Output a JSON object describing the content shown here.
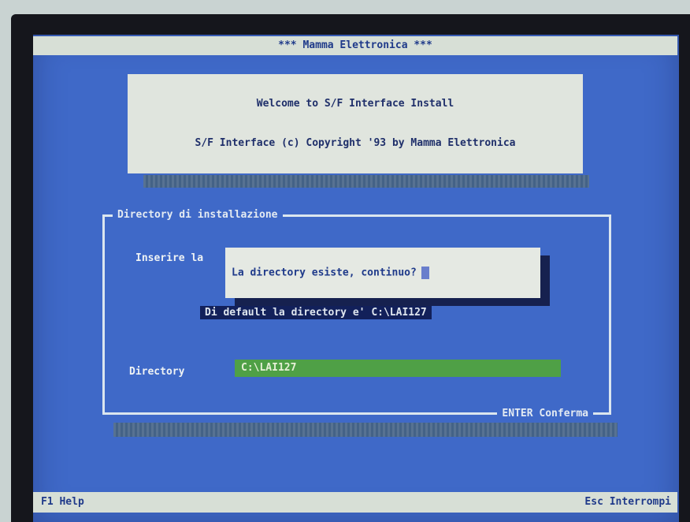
{
  "window": {
    "title": "*** Mamma Elettronica ***"
  },
  "welcome": {
    "line1": "Welcome to S/F Interface Install",
    "line2": "S/F Interface (c) Copyright '93 by Mamma Elettronica"
  },
  "install_panel": {
    "title": "Directory di installazione",
    "insert_label": "Inserire la",
    "footer": "ENTER Conferma"
  },
  "dialog": {
    "message": "La directory esiste, continuo?"
  },
  "hint": {
    "text": "Di default la directory e' C:\\LAI127"
  },
  "directory": {
    "label": "Directory",
    "value": "C:\\LAI127"
  },
  "statusbar": {
    "left": "F1 Help",
    "right": "Esc Interrompi"
  },
  "colors": {
    "screen_bg": "#3f69c8",
    "bar_bg": "#d7dfd6",
    "field_bg": "#4fa046",
    "hint_bg": "#12205a"
  }
}
